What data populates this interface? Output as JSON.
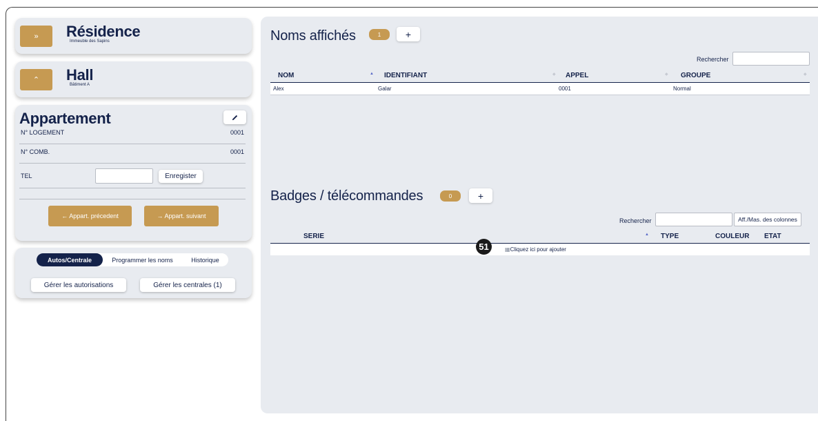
{
  "residence": {
    "title": "Résidence",
    "subtitle": "Immeuble des Sapins",
    "icon": "chevron-double-up-icon"
  },
  "hall": {
    "title": "Hall",
    "subtitle": "Bâtiment A",
    "icon": "chevron-up-icon"
  },
  "appartement": {
    "title": "Appartement",
    "edit_icon": "pencil-icon",
    "rows": [
      {
        "label": "N° LOGEMENT",
        "value": "0001"
      },
      {
        "label": "N° COMB.",
        "value": "0001"
      }
    ],
    "tel_label": "TEL",
    "tel_value": "",
    "save_label": "Enregister",
    "prev_label": "← Appart. précedent",
    "next_label": "→ Appart. suivant"
  },
  "tabs": {
    "items": [
      "Autos/Centrale",
      "Programmer les noms",
      "Historique"
    ],
    "active": 0,
    "btn_autorisations": "Gérer les autorisations",
    "btn_centrales": "Gérer les centrales (1)"
  },
  "noms": {
    "title": "Noms affichés",
    "count": "1",
    "plus": "+",
    "search_label": "Rechercher",
    "search_value": "",
    "columns": [
      "NOM",
      "IDENTIFIANT",
      "APPEL",
      "GROUPE"
    ],
    "rows": [
      [
        "Alex",
        "Galar",
        "0001",
        "Normal"
      ]
    ]
  },
  "badges": {
    "title": "Badges / télécommandes",
    "count": "0",
    "plus": "+",
    "search_label": "Rechercher",
    "search_value": "",
    "toggle_columns": "Aff./Mas. des colonnes",
    "columns": [
      "SERIE",
      "TYPE",
      "COULEUR",
      "ETAT"
    ],
    "add_text": "Cliquez ici pour ajouter",
    "marker": "51"
  },
  "colors": {
    "gold": "#c69a52",
    "navy": "#14224a",
    "panel": "#e8ebf0"
  }
}
